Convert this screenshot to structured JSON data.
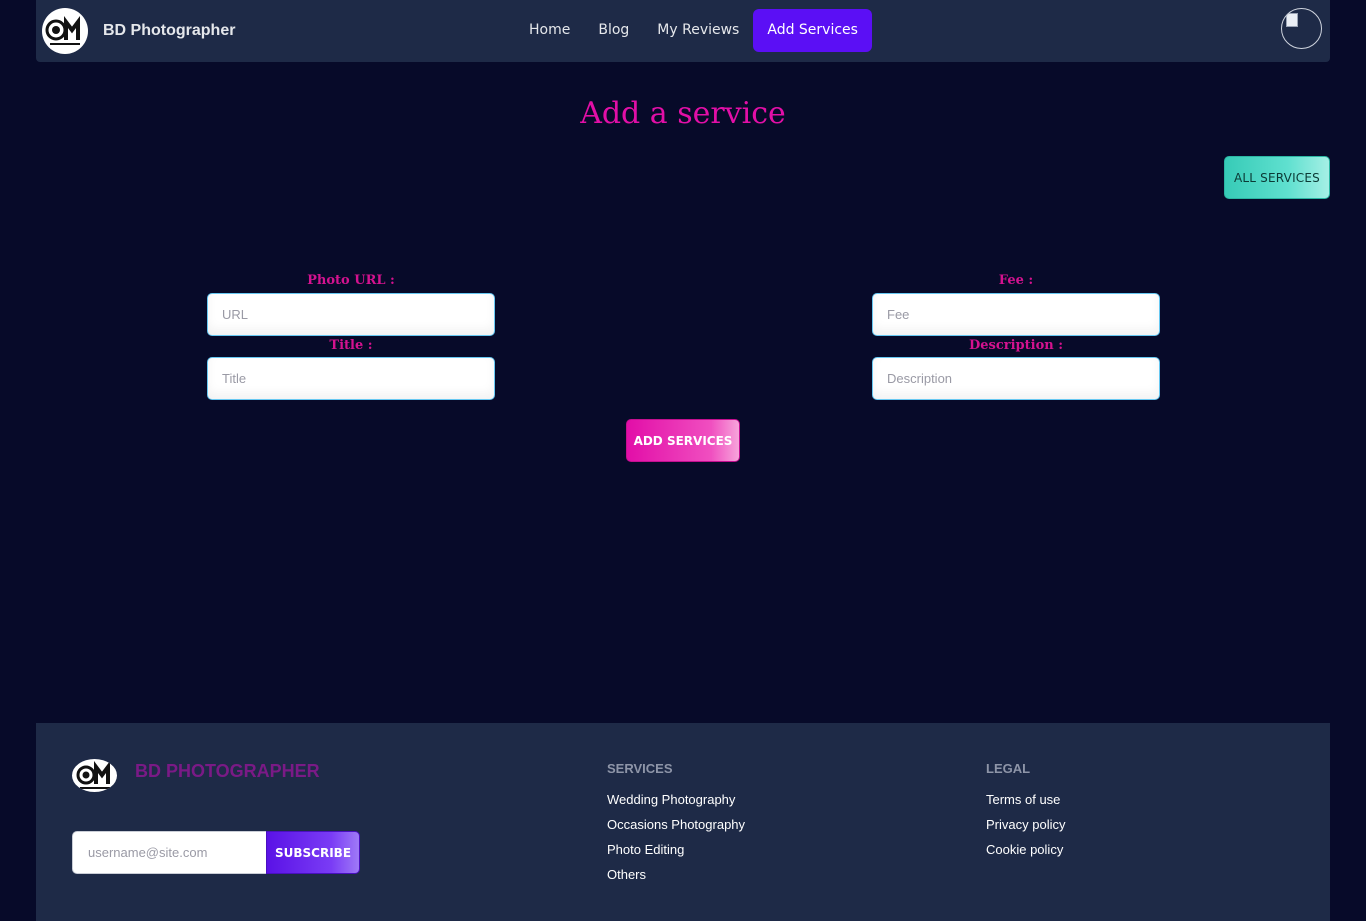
{
  "navbar": {
    "brand": "BD Photographer",
    "logo_icon": "camera-logo-icon",
    "links": [
      {
        "label": "Home",
        "active": false
      },
      {
        "label": "Blog",
        "active": false
      },
      {
        "label": "My Reviews",
        "active": false
      },
      {
        "label": "Add Services",
        "active": true
      }
    ],
    "avatar_icon": "user-avatar-icon"
  },
  "page": {
    "title": "Add a service",
    "all_services_button": "ALL SERVICES"
  },
  "form": {
    "photo_url": {
      "label": "Photo URL :",
      "placeholder": "URL",
      "value": ""
    },
    "title": {
      "label": "Title :",
      "placeholder": "Title",
      "value": ""
    },
    "fee": {
      "label": "Fee :",
      "placeholder": "Fee",
      "value": ""
    },
    "description": {
      "label": "Description :",
      "placeholder": "Description",
      "value": ""
    },
    "submit_label": "ADD SERVICES"
  },
  "footer": {
    "brand": "BD PHOTOGRAPHER",
    "subscribe": {
      "placeholder": "username@site.com",
      "button": "SUBSCRIBE"
    },
    "services": {
      "heading": "SERVICES",
      "items": [
        "Wedding Photography",
        "Occasions Photography",
        "Photo Editing",
        "Others"
      ]
    },
    "legal": {
      "heading": "LEGAL",
      "items": [
        "Terms of use",
        "Privacy policy",
        "Cookie policy"
      ]
    }
  },
  "colors": {
    "background": "#070a29",
    "navbar": "#1e2a47",
    "accent_purple": "#5b0ff5",
    "accent_pink": "#e20fa7",
    "accent_teal": "#37cbb7"
  }
}
